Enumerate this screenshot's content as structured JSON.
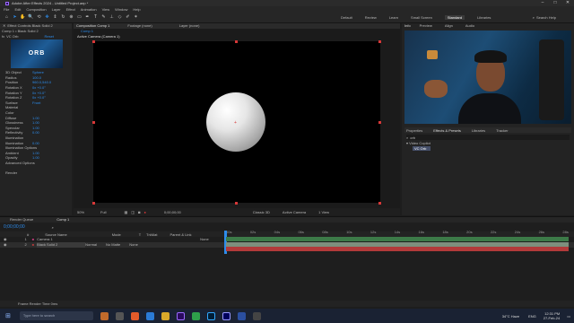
{
  "window": {
    "title": "Adobe After Effects 2024 - Untitled Project.aep *",
    "controls": [
      "–",
      "□",
      "✕"
    ]
  },
  "menu": [
    "File",
    "Edit",
    "Composition",
    "Layer",
    "Effect",
    "Animation",
    "View",
    "Window",
    "Help"
  ],
  "toolbar": {
    "workspaces": [
      "Default",
      "Review",
      "Learn",
      "Small Screen",
      "Standard",
      "Libraries"
    ],
    "active_workspace": "Standard",
    "search_label": "Search Help"
  },
  "effect_controls": {
    "tab": "Effect Controls Black Solid 2",
    "breadcrumb": "Comp 1 • Black Solid 2",
    "effect_name": "VC Orb",
    "reset_label": "Reset",
    "orb_badge": "ORB",
    "rows": [
      {
        "label": "3D Object",
        "value": "Sphere"
      },
      {
        "label": "Radius",
        "value": "100.0"
      },
      {
        "label": "Position",
        "value": "960.0,540.0"
      },
      {
        "label": "Rotation X",
        "value": "0x +0.0°"
      },
      {
        "label": "Rotation Y",
        "value": "0x +0.0°"
      },
      {
        "label": "Rotation Z",
        "value": "0x +0.0°"
      },
      {
        "label": "Surface",
        "value": "Front"
      },
      {
        "label": "Material",
        "value": ""
      },
      {
        "label": "Color",
        "value": ""
      },
      {
        "label": "Diffuse",
        "value": "1.00"
      },
      {
        "label": "Glossiness",
        "value": "1.00"
      },
      {
        "label": "Specular",
        "value": "1.00"
      },
      {
        "label": "Reflectivity",
        "value": "0.00"
      },
      {
        "label": "Illumination",
        "value": ""
      },
      {
        "label": "Illumination",
        "value": "0.00"
      },
      {
        "label": "Illumination Options",
        "value": ""
      },
      {
        "label": "Ambient",
        "value": "1.00"
      },
      {
        "label": "Opacity",
        "value": "1.00"
      },
      {
        "label": "Advanced Options",
        "value": ""
      }
    ],
    "render_label": "Render"
  },
  "composition": {
    "tabs": [
      "Composition Comp 1",
      "Footage (none)",
      "Layer (none)"
    ],
    "subtab": "Comp 1",
    "camera_label": "Active Camera (Camera 1)",
    "zoom": "50%",
    "resolution": "Full",
    "timecode": "0;00;00;00",
    "renderer": "Classic 3D",
    "camera_view": "Active Camera",
    "views": "1 View"
  },
  "right_panel": {
    "top_tabs": [
      "Info",
      "Preview",
      "Align",
      "Audio"
    ],
    "lower_tabs": [
      "Properties",
      "Effects & Presets",
      "Libraries",
      "Tracker"
    ],
    "search_value": "orb",
    "category": "Video Copilot",
    "effect_item": "VC Orb"
  },
  "timeline": {
    "tabs": [
      "Render Queue",
      "Comp 1"
    ],
    "timecode": "0;00;00;00",
    "columns": [
      "#",
      "Source Name",
      "Mode",
      "T",
      "TrkMat",
      "Parent & Link"
    ],
    "layers": [
      {
        "num": "1",
        "name": "Camera 1",
        "mode": "",
        "trkmat": "",
        "parent": "None"
      },
      {
        "num": "2",
        "name": "Black Solid 2",
        "mode": "Normal",
        "trkmat": "No Matte",
        "parent": "None"
      }
    ],
    "ruler": [
      "00s",
      "02s",
      "04s",
      "06s",
      "08s",
      "10s",
      "12s",
      "14s",
      "16s",
      "18s",
      "20s",
      "22s",
      "24s",
      "26s",
      "28s"
    ],
    "footer": "Frame Render Time  0ms"
  },
  "taskbar": {
    "search_placeholder": "Type here to search",
    "weather": "34°C  Haze",
    "time": "12:31 PM",
    "date": "27-Feb-24",
    "lang": "ENG"
  },
  "colors": {
    "accent": "#2d8ceb",
    "layer_camera": "#c0397a",
    "track_green": "#3c7a48",
    "track_red": "#b23a3a"
  }
}
